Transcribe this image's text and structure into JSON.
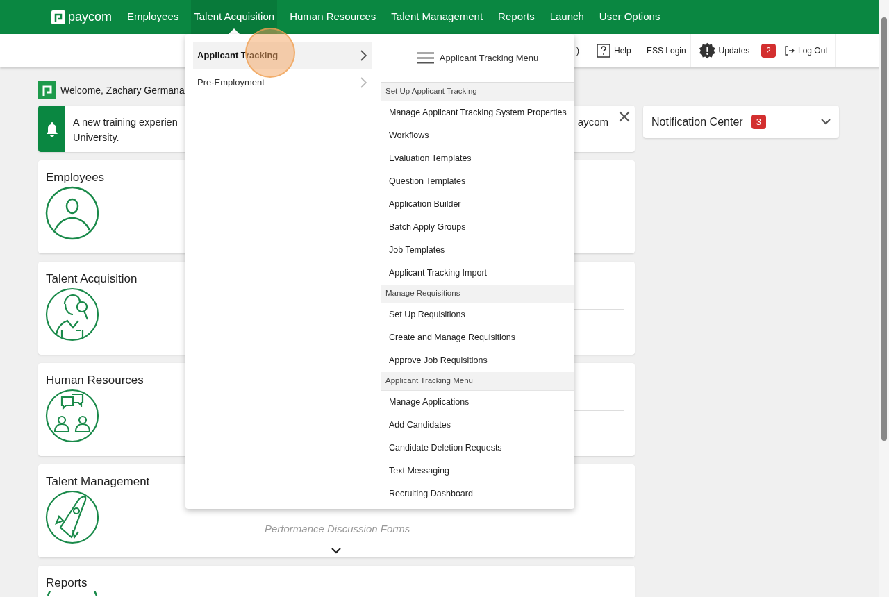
{
  "nav": {
    "logo": "paycom",
    "items": [
      {
        "label": "Employees",
        "selected": false
      },
      {
        "label": "Talent Acquisition",
        "selected": true
      },
      {
        "label": "Human Resources",
        "selected": false
      },
      {
        "label": "Talent Management",
        "selected": false
      },
      {
        "label": "Reports",
        "selected": false
      },
      {
        "label": "Launch",
        "selected": false
      },
      {
        "label": "User Options",
        "selected": false
      }
    ]
  },
  "toolbar": {
    "partial_text": ")",
    "buttons": [
      {
        "kind": "help",
        "label": "Help"
      },
      {
        "kind": "plain",
        "label": "ESS Login"
      },
      {
        "kind": "updates",
        "label": "Updates",
        "badge": "2"
      },
      {
        "kind": "logout",
        "label": "Log Out"
      }
    ]
  },
  "welcome": "Welcome, Zachary Germana",
  "banner": {
    "line_1": "A new training experien",
    "line_2": "University.",
    "tail": "aycom"
  },
  "cards": [
    {
      "title": "Employees"
    },
    {
      "title": "Talent Acquisition"
    },
    {
      "title": "Human Resources"
    },
    {
      "title": "Talent Management",
      "link": "Performance Discussion Forms"
    },
    {
      "title": "Reports"
    }
  ],
  "notification_center": {
    "label": "Notification Center",
    "count": "3"
  },
  "menu": {
    "left_items": [
      {
        "label": "Applicant Tracking",
        "selected": true
      },
      {
        "label": "Pre-Employment",
        "selected": false
      }
    ],
    "header": "Applicant Tracking Menu",
    "sections": [
      {
        "heading": "Set Up Applicant Tracking",
        "items": [
          "Manage Applicant Tracking System Properties",
          "Workflows",
          "Evaluation Templates",
          "Question Templates",
          "Application Builder",
          "Batch Apply Groups",
          "Job Templates",
          "Applicant Tracking Import"
        ]
      },
      {
        "heading": "Manage Requisitions",
        "items": [
          "Set Up Requisitions",
          "Create and Manage Requisitions",
          "Approve Job Requisitions"
        ]
      },
      {
        "heading": "Applicant Tracking Menu",
        "items": [
          "Manage Applications",
          "Add Candidates",
          "Candidate Deletion Requests",
          "Text Messaging",
          "Recruiting Dashboard"
        ]
      }
    ]
  }
}
